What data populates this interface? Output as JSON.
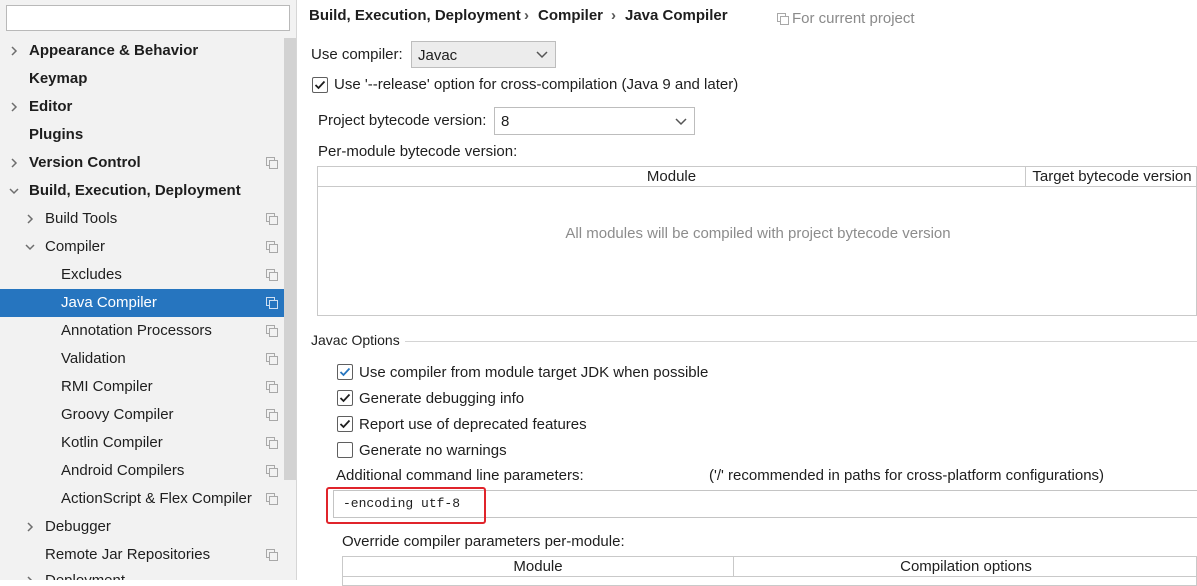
{
  "search": {
    "value": ""
  },
  "sidebar": {
    "items": [
      {
        "label": "Appearance & Behavior"
      },
      {
        "label": "Keymap"
      },
      {
        "label": "Editor"
      },
      {
        "label": "Plugins"
      },
      {
        "label": "Version Control"
      },
      {
        "label": "Build, Execution, Deployment"
      },
      {
        "label": "Build Tools"
      },
      {
        "label": "Compiler"
      },
      {
        "label": "Excludes"
      },
      {
        "label": "Java Compiler"
      },
      {
        "label": "Annotation Processors"
      },
      {
        "label": "Validation"
      },
      {
        "label": "RMI Compiler"
      },
      {
        "label": "Groovy Compiler"
      },
      {
        "label": "Kotlin Compiler"
      },
      {
        "label": "Android Compilers"
      },
      {
        "label": "ActionScript & Flex Compiler"
      },
      {
        "label": "Debugger"
      },
      {
        "label": "Remote Jar Repositories"
      },
      {
        "label": "Deployment"
      }
    ],
    "selected": "Java Compiler",
    "selected_color": "#2675bf"
  },
  "breadcrumb": {
    "items": [
      "Build, Execution, Deployment",
      "Compiler",
      "Java Compiler"
    ],
    "separator": "›",
    "scope_note": "For current project"
  },
  "compiler": {
    "use_compiler_label": "Use compiler:",
    "use_compiler_value": "Javac",
    "release_option_label": "Use '--release' option for cross-compilation (Java 9 and later)",
    "release_option_checked": true,
    "bytecode_label": "Project bytecode version:",
    "bytecode_value": "8",
    "per_module_label": "Per-module bytecode version:",
    "module_table": {
      "columns": [
        "Module",
        "Target bytecode version"
      ],
      "empty_text": "All modules will be compiled with project bytecode version"
    }
  },
  "javac": {
    "section_title": "Javac Options",
    "options": [
      {
        "label": "Use compiler from module target JDK when possible",
        "checked": true
      },
      {
        "label": "Generate debugging info",
        "checked": true
      },
      {
        "label": "Report use of deprecated features",
        "checked": true
      },
      {
        "label": "Generate no warnings",
        "checked": false
      }
    ],
    "params_label": "Additional command line parameters:",
    "params_hint": "('/' recommended in paths for cross-platform configurations)",
    "params_value": "-encoding utf-8",
    "override_label": "Override compiler parameters per-module:",
    "override_table": {
      "columns": [
        "Module",
        "Compilation options"
      ]
    }
  },
  "colors": {
    "accent": "#2675bf",
    "check": "#2675bf",
    "highlight": "#e0242b"
  }
}
